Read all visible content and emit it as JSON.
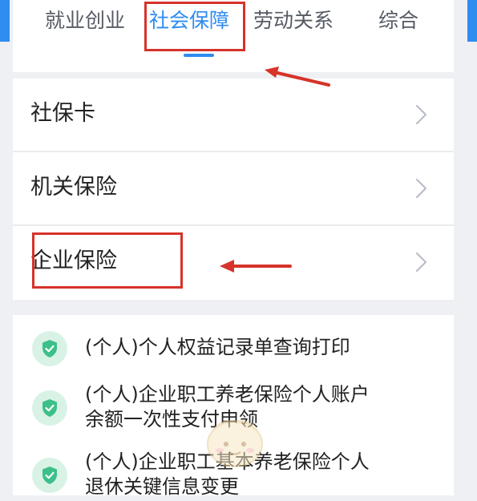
{
  "tabs": [
    {
      "label": "就业创业",
      "active": false
    },
    {
      "label": "社会保障",
      "active": true
    },
    {
      "label": "劳动关系",
      "active": false
    },
    {
      "label": "综合",
      "active": false
    }
  ],
  "menu": [
    {
      "label": "社保卡",
      "icon": "chevron-right-icon"
    },
    {
      "label": "机关保险",
      "icon": "chevron-right-icon"
    },
    {
      "label": "企业保险",
      "icon": "chevron-right-icon"
    }
  ],
  "services": [
    {
      "lines": [
        "(个人)个人权益记录单查询打印"
      ],
      "icon": "shield-check-icon"
    },
    {
      "lines": [
        "(个人)企业职工养老保险个人账户",
        "余额一次性支付申领"
      ],
      "icon": "shield-check-icon"
    },
    {
      "lines": [
        "(个人)企业职工基本养老保险个人",
        "退休关键信息变更"
      ],
      "icon": "shield-check-icon"
    }
  ],
  "colors": {
    "accent": "#2f8cf0",
    "annotation_red": "#d6332a",
    "shield_green": "#3dbf8a",
    "background": "#eef0f3"
  }
}
